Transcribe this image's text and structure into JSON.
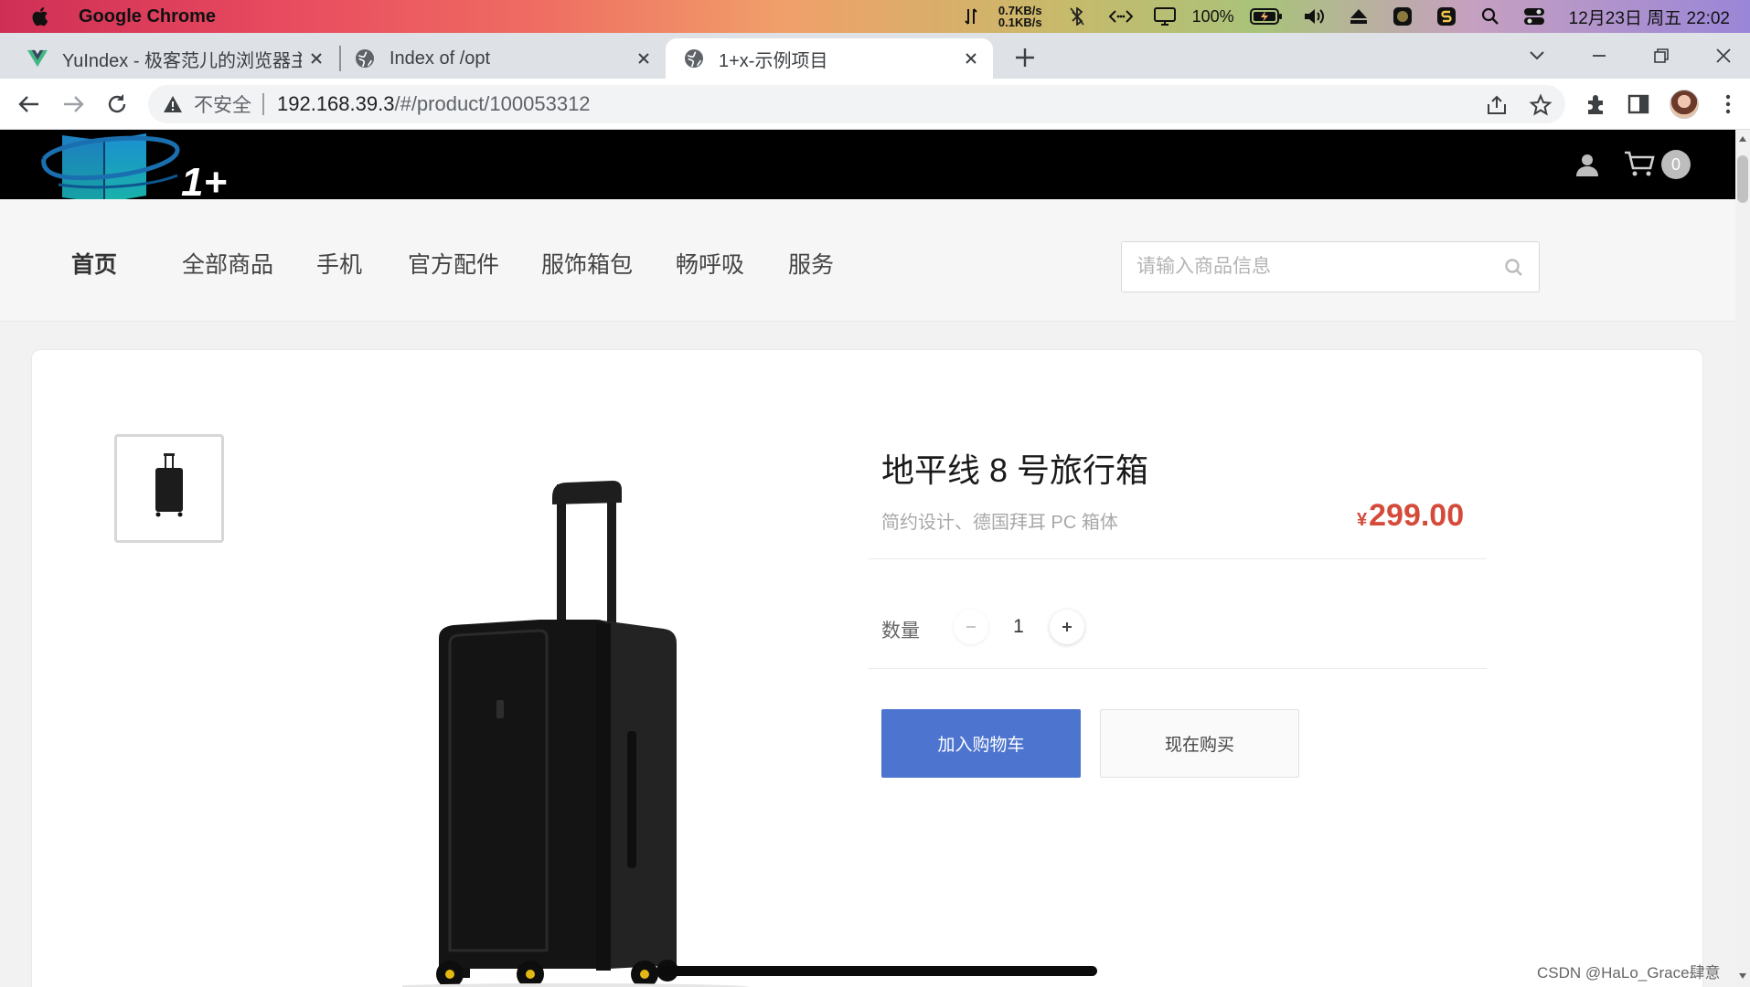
{
  "menubar": {
    "app_name": "Google Chrome",
    "net_up": "0.7KB/s",
    "net_down": "0.1KB/s",
    "battery": "100%",
    "datetime": "12月23日 周五 22:02"
  },
  "tabs": [
    {
      "title": "YuIndex - 极客范儿的浏览器主页",
      "favicon": "vue-icon"
    },
    {
      "title": "Index of /opt",
      "favicon": "globe-icon"
    },
    {
      "title": "1+x-示例项目",
      "favicon": "globe-icon",
      "active": true
    }
  ],
  "omnibox": {
    "security_label": "不安全",
    "host": "192.168.39.3",
    "path": "/#/product/100053312"
  },
  "site": {
    "logo_text": "1+",
    "cart_count": "0"
  },
  "nav": {
    "items": [
      "首页",
      "全部商品",
      "手机",
      "官方配件",
      "服饰箱包",
      "畅呼吸",
      "服务"
    ],
    "search_placeholder": "请输入商品信息"
  },
  "product": {
    "title": "地平线 8 号旅行箱",
    "subtitle": "简约设计、德国拜耳 PC 箱体",
    "currency": "¥",
    "price": "299.00",
    "quantity_label": "数量",
    "quantity": "1",
    "add_to_cart": "加入购物车",
    "buy_now": "现在购买"
  },
  "watermark": "CSDN @HaLo_Grace肆意",
  "colors": {
    "accent_blue": "#4d74cf",
    "price_red": "#d44b3a",
    "header_black": "#000000"
  }
}
